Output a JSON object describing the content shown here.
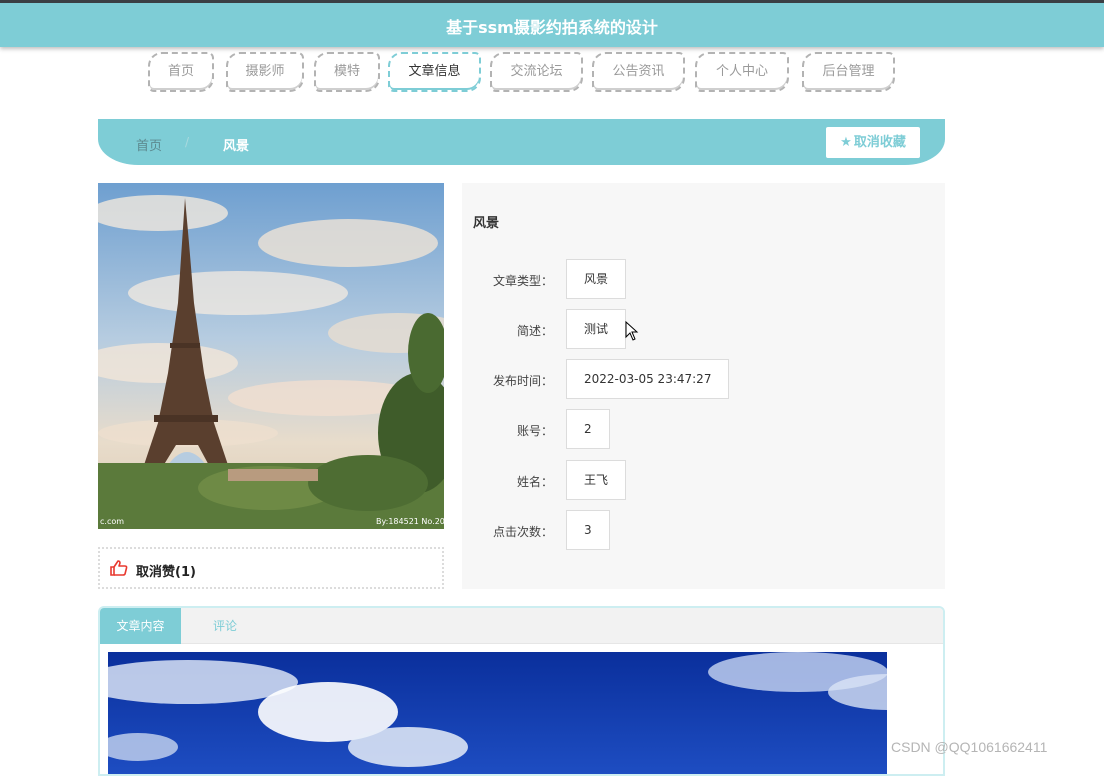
{
  "header": {
    "title": "基于ssm摄影约拍系统的设计"
  },
  "nav": {
    "items": [
      {
        "label": "首页",
        "active": false
      },
      {
        "label": "摄影师",
        "active": false
      },
      {
        "label": "模特",
        "active": false
      },
      {
        "label": "文章信息",
        "active": true
      },
      {
        "label": "交流论坛",
        "active": false
      },
      {
        "label": "公告资讯",
        "active": false
      },
      {
        "label": "个人中心",
        "active": false
      },
      {
        "label": "后台管理",
        "active": false
      }
    ]
  },
  "breadcrumb": {
    "home": "首页",
    "separator": "/",
    "current": "风景"
  },
  "favorite_button": {
    "label": "取消收藏",
    "icon": "star-icon"
  },
  "like": {
    "label": "取消赞(1)",
    "icon": "thumbs-up-icon"
  },
  "article": {
    "title": "风景",
    "fields": [
      {
        "label": "文章类型：",
        "value": "风景"
      },
      {
        "label": "简述：",
        "value": "测试"
      },
      {
        "label": "发布时间：",
        "value": "2022-03-05 23:47:27"
      },
      {
        "label": "账号：",
        "value": "2"
      },
      {
        "label": "姓名：",
        "value": "王飞"
      },
      {
        "label": "点击次数：",
        "value": "3"
      }
    ]
  },
  "tabs": [
    {
      "label": "文章内容",
      "active": true
    },
    {
      "label": "评论",
      "active": false
    }
  ],
  "image": {
    "photo_caption_left": "c.com",
    "photo_caption_right": "By:184521  No.20"
  },
  "watermark": "CSDN @QQ1061662411",
  "colors": {
    "accent": "#7ecdd6",
    "like_icon": "#e8392f"
  }
}
